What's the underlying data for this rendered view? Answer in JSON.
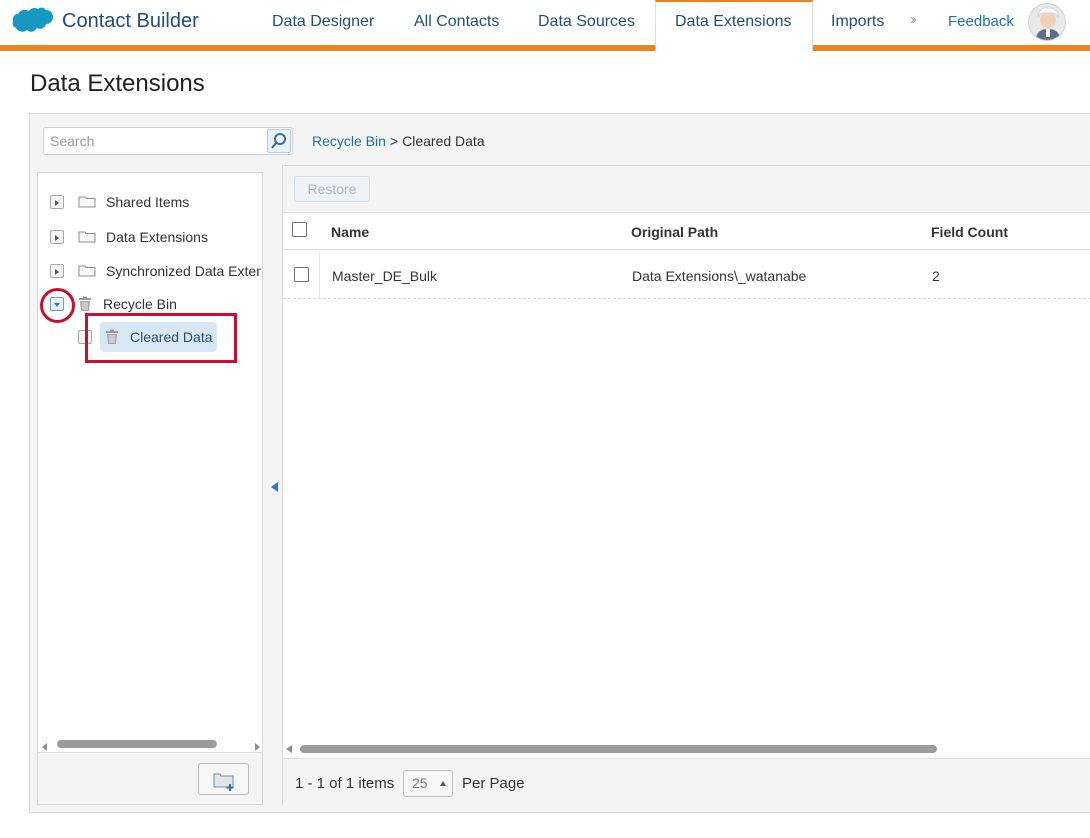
{
  "app": {
    "title": "Contact Builder",
    "brand_color": "#e8841a",
    "link_color": "#1f6fb0"
  },
  "nav": {
    "items": [
      {
        "label": "Data Designer"
      },
      {
        "label": "All Contacts"
      },
      {
        "label": "Data Sources"
      },
      {
        "label": "Data Extensions"
      },
      {
        "label": "Imports"
      }
    ],
    "active_index": 3,
    "more_icon": "double-chevron-right-icon",
    "feedback_label": "Feedback"
  },
  "page": {
    "title": "Data Extensions"
  },
  "search": {
    "placeholder": "Search"
  },
  "breadcrumb": {
    "parent": "Recycle Bin",
    "separator": ">",
    "current": "Cleared Data"
  },
  "tree": {
    "items": [
      {
        "label": "Shared Items",
        "icon": "folder-icon",
        "state": "collapsed"
      },
      {
        "label": "Data Extensions",
        "icon": "folder-icon",
        "state": "collapsed"
      },
      {
        "label": "Synchronized Data Extensions",
        "icon": "folder-icon",
        "state": "collapsed"
      },
      {
        "label": "Recycle Bin",
        "icon": "trash-icon",
        "state": "expanded"
      },
      {
        "label": "Cleared Data",
        "icon": "trash-icon",
        "state": "selected"
      }
    ]
  },
  "toolbar": {
    "restore_label": "Restore"
  },
  "table": {
    "columns": [
      "Name",
      "Original Path",
      "Field Count"
    ],
    "rows": [
      {
        "name": "Master_DE_Bulk",
        "original_path": "Data Extensions\\_watanabe",
        "field_count": "2"
      }
    ]
  },
  "pager": {
    "summary": "1 - 1 of 1 items",
    "per_page_value": "25",
    "per_page_label": "Per Page"
  }
}
